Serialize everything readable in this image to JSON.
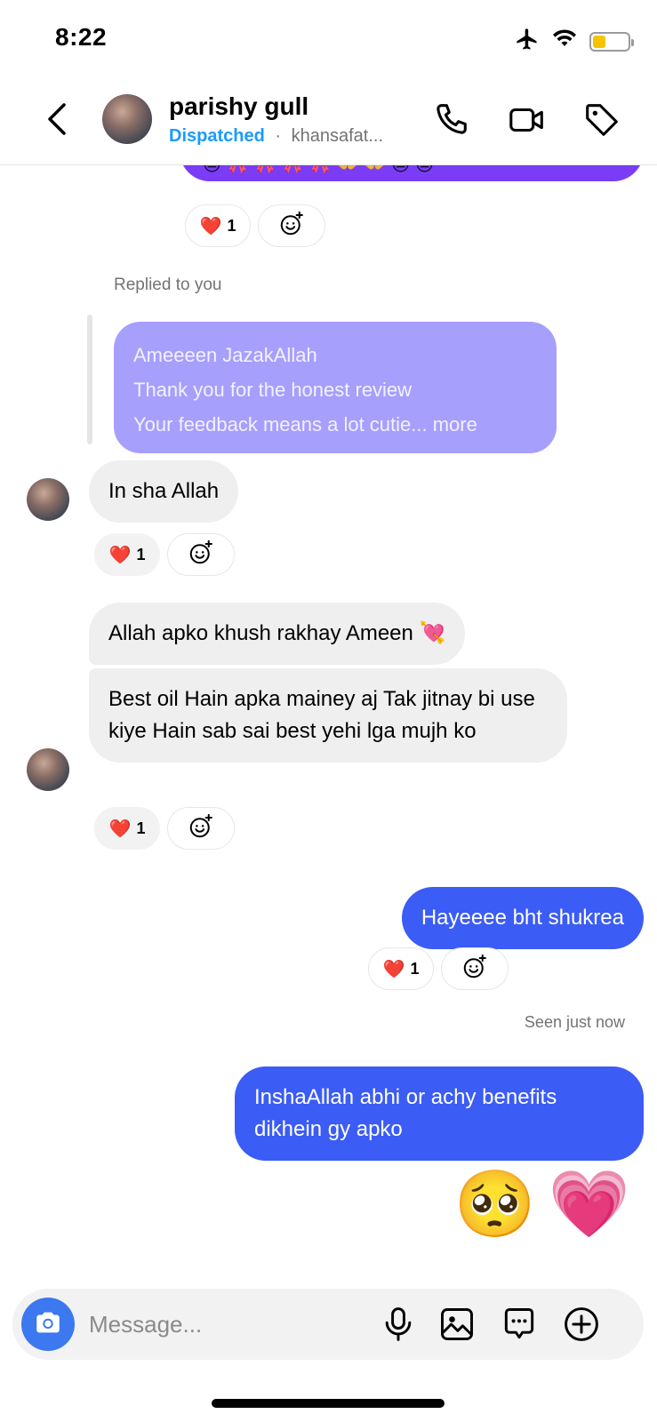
{
  "status_bar": {
    "time": "8:22",
    "icons": [
      "airplane-icon",
      "wifi-icon",
      "battery-icon"
    ],
    "battery_color": "#f5c400"
  },
  "header": {
    "contact_name": "parishy gull",
    "status_label": "Dispatched",
    "separator": "·",
    "subtitle": "khansafat...",
    "icons": [
      "back-chevron-icon",
      "phone-icon",
      "video-camera-icon",
      "tag-icon"
    ]
  },
  "colors": {
    "outgoing_bubble": "#3b5cf5",
    "incoming_bubble": "#efefef",
    "reply_bubble": "#a79ffc",
    "top_bubble": "#7a3cf5",
    "dispatched": "#1a9bff",
    "camera_button": "#3c78f0"
  },
  "top_bubble": {
    "emojis": "😔🎀🎀🎀🎀👐👐😔😔",
    "reaction": {
      "emoji": "❤️",
      "count": "1"
    }
  },
  "reply": {
    "label": "Replied to you",
    "lines": [
      "Ameeeen JazakAllah",
      "Thank you for the honest review",
      "Your feedback means a lot cutie... more"
    ]
  },
  "messages": [
    {
      "direction": "in",
      "text": "In sha Allah",
      "reaction": {
        "emoji": "❤️",
        "count": "1"
      }
    },
    {
      "direction": "in",
      "text": "Allah apko khush rakhay Ameen 💘"
    },
    {
      "direction": "in",
      "text": "Best oil Hain apka mainey aj Tak jitnay bi use kiye Hain sab sai best yehi lga mujh ko",
      "reaction": {
        "emoji": "❤️",
        "count": "1"
      }
    },
    {
      "direction": "out",
      "text": "Hayeeee bht shukrea",
      "reaction": {
        "emoji": "❤️",
        "count": "1"
      }
    },
    {
      "direction": "out",
      "text": "InshaAllah abhi or achy benefits dikhein gy apko"
    }
  ],
  "seen_label": "Seen just now",
  "emoji_message": [
    "🥺",
    "💗"
  ],
  "composer": {
    "placeholder": "Message...",
    "icons": [
      "camera-icon",
      "microphone-icon",
      "gallery-icon",
      "sticker-chat-icon",
      "plus-icon"
    ]
  }
}
